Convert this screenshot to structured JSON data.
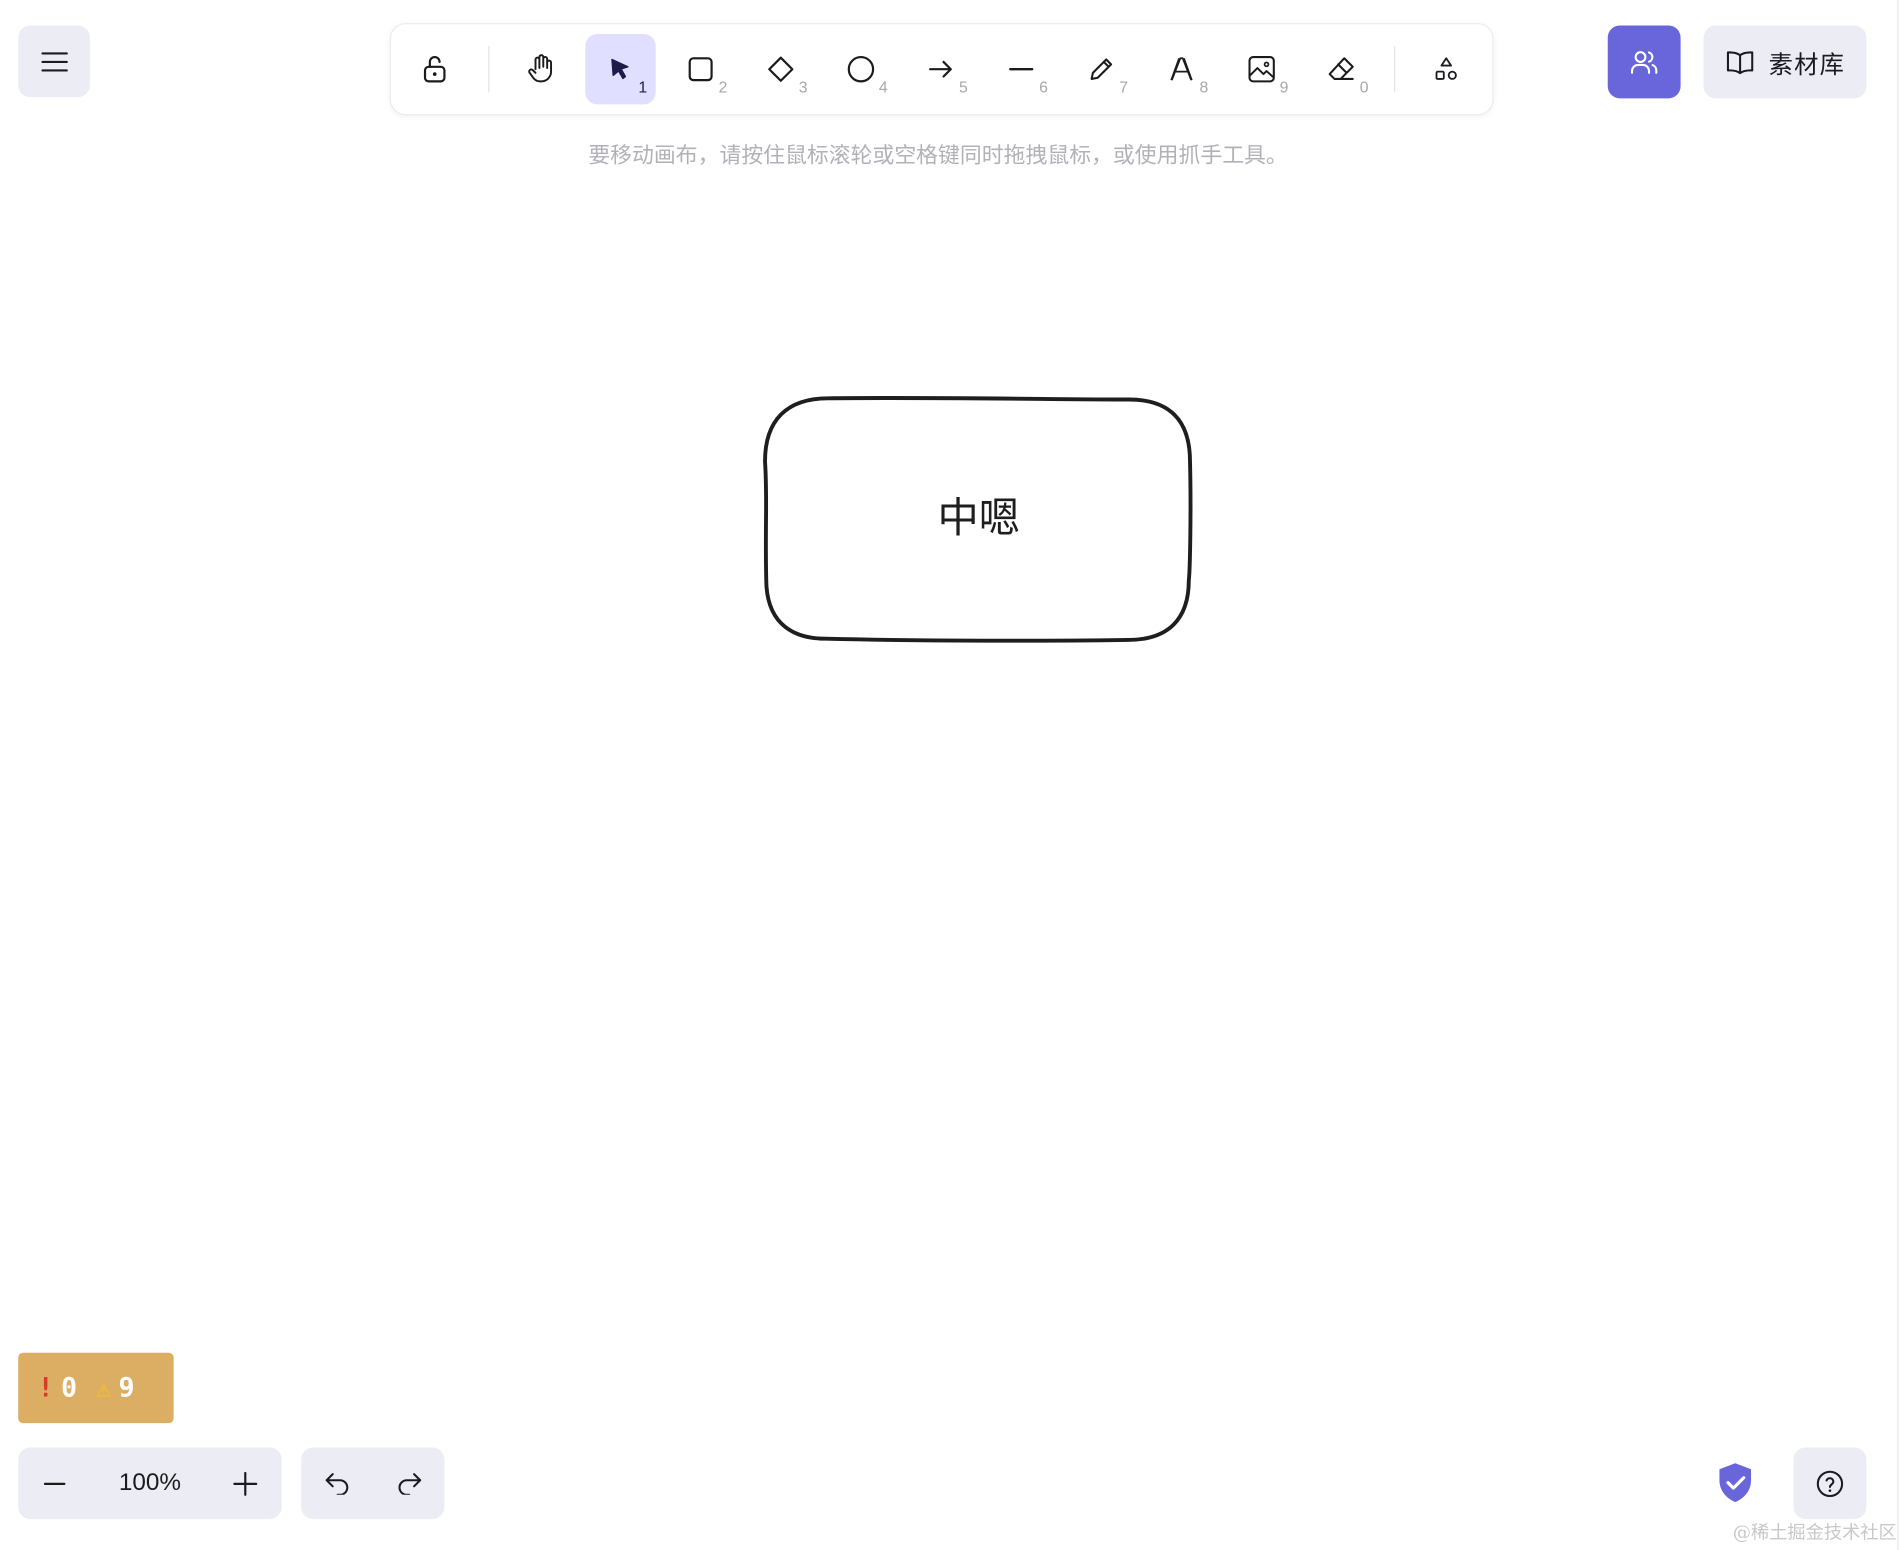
{
  "menu": {
    "icon": "hamburger-menu-icon"
  },
  "toolbar": {
    "tools": [
      {
        "name": "lock",
        "icon": "unlock-icon",
        "key": ""
      },
      {
        "name": "hand",
        "icon": "hand-icon",
        "key": ""
      },
      {
        "name": "selection",
        "icon": "pointer-icon",
        "key": "1",
        "active": true
      },
      {
        "name": "rectangle",
        "icon": "square-icon",
        "key": "2"
      },
      {
        "name": "diamond",
        "icon": "diamond-icon",
        "key": "3"
      },
      {
        "name": "ellipse",
        "icon": "circle-icon",
        "key": "4"
      },
      {
        "name": "arrow",
        "icon": "arrow-right-icon",
        "key": "5"
      },
      {
        "name": "line",
        "icon": "line-icon",
        "key": "6"
      },
      {
        "name": "draw",
        "icon": "pencil-icon",
        "key": "7"
      },
      {
        "name": "text",
        "icon": "text-a-icon",
        "key": "8"
      },
      {
        "name": "image",
        "icon": "image-icon",
        "key": "9"
      },
      {
        "name": "eraser",
        "icon": "eraser-icon",
        "key": "0"
      },
      {
        "name": "extra-shapes",
        "icon": "shapes-icon",
        "key": ""
      }
    ],
    "active_color": "#e0dfff"
  },
  "collab": {
    "icon": "users-icon",
    "color": "#6965db"
  },
  "library": {
    "label": "素材库",
    "icon": "book-icon"
  },
  "hint": {
    "text": "要移动画布，请按住鼠标滚轮或空格键同时拖拽鼠标，或使用抓手工具。"
  },
  "canvas": {
    "shape_text": "中嗯"
  },
  "status": {
    "errors": "0",
    "warnings": "9",
    "bg_color": "#dcae64"
  },
  "zoom": {
    "value": "100%"
  },
  "watermark": {
    "text": "@稀土掘金技术社区"
  }
}
